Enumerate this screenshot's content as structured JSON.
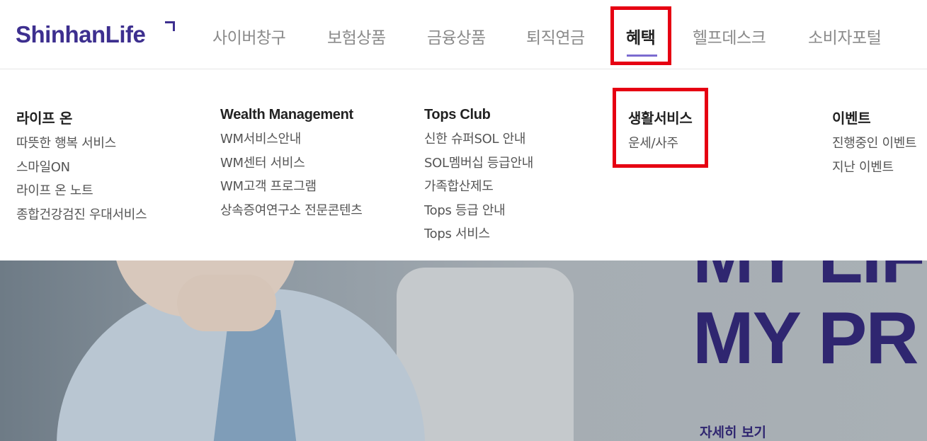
{
  "header": {
    "logo_text": "ShinhanLife",
    "nav": [
      {
        "label": "사이버창구"
      },
      {
        "label": "보험상품"
      },
      {
        "label": "금융상품"
      },
      {
        "label": "퇴직연금"
      },
      {
        "label": "혜택",
        "active": true
      },
      {
        "label": "헬프데스크"
      },
      {
        "label": "소비자포털"
      }
    ]
  },
  "mega_menu": {
    "columns": [
      {
        "title": "라이프 온",
        "items": [
          "따뜻한 행복 서비스",
          "스마일ON",
          "라이프 온 노트",
          "종합건강검진 우대서비스"
        ]
      },
      {
        "title": "Wealth Management",
        "items": [
          "WM서비스안내",
          "WM센터 서비스",
          "WM고객 프로그램",
          "상속증여연구소 전문콘텐츠"
        ]
      },
      {
        "title": "Tops Club",
        "items": [
          "신한 슈퍼SOL 안내",
          "SOL멤버십 등급안내",
          "가족합산제도",
          "Tops 등급 안내",
          "Tops 서비스"
        ]
      },
      {
        "title": "생활서비스",
        "items": [
          "운세/사주"
        ]
      },
      {
        "title": "이벤트",
        "items": [
          "진행중인 이벤트",
          "지난 이벤트"
        ]
      }
    ]
  },
  "hero": {
    "headline_line1": "MY LIFE",
    "headline_line2": "MY PR",
    "more_label": "자세히 보기"
  },
  "colors": {
    "brand": "#3d2f8f",
    "highlight": "#e60012",
    "active_underline": "#7b6bd0"
  }
}
